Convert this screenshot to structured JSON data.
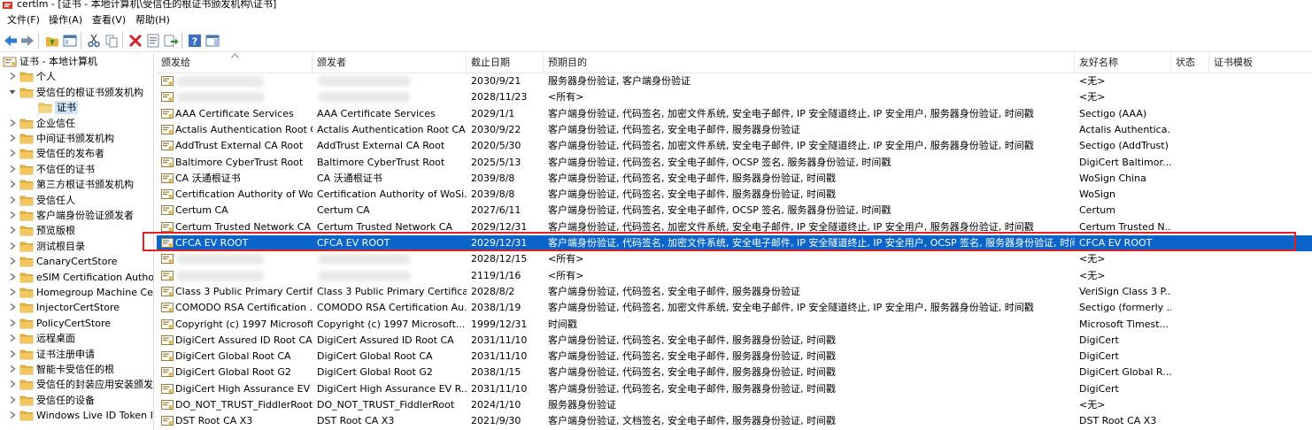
{
  "window": {
    "title": "certlm - [证书 - 本地计算机\\受信任的根证书颁发机构\\证书]"
  },
  "menu": [
    {
      "label": "文件(F)"
    },
    {
      "label": "操作(A)"
    },
    {
      "label": "查看(V)"
    },
    {
      "label": "帮助(H)"
    }
  ],
  "tree": {
    "items": [
      {
        "label": "证书 - 本地计算机",
        "level": 0,
        "expander": "none",
        "icon": "cert-store-icon"
      },
      {
        "label": "个人",
        "level": 1,
        "expander": "collapsed",
        "icon": "folder-icon"
      },
      {
        "label": "受信任的根证书颁发机构",
        "level": 1,
        "expander": "expanded",
        "icon": "folder-icon"
      },
      {
        "label": "证书",
        "level": 2,
        "expander": "none",
        "icon": "folder-open-icon",
        "selected": true
      },
      {
        "label": "企业信任",
        "level": 1,
        "expander": "collapsed",
        "icon": "folder-icon"
      },
      {
        "label": "中间证书颁发机构",
        "level": 1,
        "expander": "collapsed",
        "icon": "folder-icon"
      },
      {
        "label": "受信任的发布者",
        "level": 1,
        "expander": "collapsed",
        "icon": "folder-icon"
      },
      {
        "label": "不信任的证书",
        "level": 1,
        "expander": "collapsed",
        "icon": "folder-icon"
      },
      {
        "label": "第三方根证书颁发机构",
        "level": 1,
        "expander": "collapsed",
        "icon": "folder-icon"
      },
      {
        "label": "受信任人",
        "level": 1,
        "expander": "collapsed",
        "icon": "folder-icon"
      },
      {
        "label": "客户端身份验证颁发者",
        "level": 1,
        "expander": "collapsed",
        "icon": "folder-icon"
      },
      {
        "label": "预览版根",
        "level": 1,
        "expander": "collapsed",
        "icon": "folder-icon"
      },
      {
        "label": "测试根目录",
        "level": 1,
        "expander": "collapsed",
        "icon": "folder-icon"
      },
      {
        "label": "CanaryCertStore",
        "level": 1,
        "expander": "collapsed",
        "icon": "folder-icon"
      },
      {
        "label": "eSIM Certification Authorities",
        "level": 1,
        "expander": "collapsed",
        "icon": "folder-icon"
      },
      {
        "label": "Homegroup Machine Certificates",
        "level": 1,
        "expander": "collapsed",
        "icon": "folder-icon"
      },
      {
        "label": "InjectorCertStore",
        "level": 1,
        "expander": "collapsed",
        "icon": "folder-icon"
      },
      {
        "label": "PolicyCertStore",
        "level": 1,
        "expander": "collapsed",
        "icon": "folder-icon"
      },
      {
        "label": "远程桌面",
        "level": 1,
        "expander": "collapsed",
        "icon": "folder-icon"
      },
      {
        "label": "证书注册申请",
        "level": 1,
        "expander": "collapsed",
        "icon": "folder-icon"
      },
      {
        "label": "智能卡受信任的根",
        "level": 1,
        "expander": "collapsed",
        "icon": "folder-icon"
      },
      {
        "label": "受信任的封装应用安装颁发机构",
        "level": 1,
        "expander": "collapsed",
        "icon": "folder-icon"
      },
      {
        "label": "受信任的设备",
        "level": 1,
        "expander": "collapsed",
        "icon": "folder-icon"
      },
      {
        "label": "Windows Live ID Token Issuer",
        "level": 1,
        "expander": "collapsed",
        "icon": "folder-icon"
      }
    ]
  },
  "list": {
    "columns": [
      "颁发给",
      "颁发者",
      "截止日期",
      "预期目的",
      "友好名称",
      "状态",
      "证书模板"
    ],
    "rows": [
      {
        "issued_to": "",
        "issuer": "",
        "expires": "2030/9/21",
        "purposes": "服务器身份验证, 客户端身份验证",
        "friendly": "<无>",
        "blurred": true
      },
      {
        "issued_to": "",
        "issuer": "",
        "expires": "2028/11/23",
        "purposes": "<所有>",
        "friendly": "<无>",
        "blurred": true
      },
      {
        "issued_to": "AAA Certificate Services",
        "issuer": "AAA Certificate Services",
        "expires": "2029/1/1",
        "purposes": "客户端身份验证, 代码签名, 加密文件系统, 安全电子邮件, IP 安全隧道终止, IP 安全用户, 服务器身份验证, 时间戳",
        "friendly": "Sectigo (AAA)"
      },
      {
        "issued_to": "Actalis Authentication Root CA",
        "issuer": "Actalis Authentication Root CA",
        "expires": "2030/9/22",
        "purposes": "客户端身份验证, 代码签名, 安全电子邮件, 服务器身份验证",
        "friendly": "Actalis Authentica..."
      },
      {
        "issued_to": "AddTrust External CA Root",
        "issuer": "AddTrust External CA Root",
        "expires": "2020/5/30",
        "purposes": "客户端身份验证, 代码签名, 加密文件系统, 安全电子邮件, IP 安全隧道终止, IP 安全用户, 服务器身份验证, 时间戳",
        "friendly": "Sectigo (AddTrust)"
      },
      {
        "issued_to": "Baltimore CyberTrust Root",
        "issuer": "Baltimore CyberTrust Root",
        "expires": "2025/5/13",
        "purposes": "客户端身份验证, 代码签名, 安全电子邮件, OCSP 签名, 服务器身份验证, 时间戳",
        "friendly": "DigiCert Baltimor..."
      },
      {
        "issued_to": "CA 沃通根证书",
        "issuer": "CA 沃通根证书",
        "expires": "2039/8/8",
        "purposes": "客户端身份验证, 代码签名, 安全电子邮件, 服务器身份验证, 时间戳",
        "friendly": "WoSign China"
      },
      {
        "issued_to": "Certification Authority of Wo...",
        "issuer": "Certification Authority of WoSi...",
        "expires": "2039/8/8",
        "purposes": "客户端身份验证, 代码签名, 安全电子邮件, 服务器身份验证, 时间戳",
        "friendly": "WoSign"
      },
      {
        "issued_to": "Certum CA",
        "issuer": "Certum CA",
        "expires": "2027/6/11",
        "purposes": "客户端身份验证, 代码签名, 安全电子邮件, OCSP 签名, 服务器身份验证, 时间戳",
        "friendly": "Certum"
      },
      {
        "issued_to": "Certum Trusted Network CA",
        "issuer": "Certum Trusted Network CA",
        "expires": "2029/12/31",
        "purposes": "客户端身份验证, 代码签名, 加密文件系统, 安全电子邮件, IP 安全隧道终止, IP 安全用户, 服务器身份验证, 时间戳",
        "friendly": "Certum Trusted N..."
      },
      {
        "issued_to": "CFCA EV ROOT",
        "issuer": "CFCA EV ROOT",
        "expires": "2029/12/31",
        "purposes": "客户端身份验证, 代码签名, 加密文件系统, 安全电子邮件, IP 安全隧道终止, IP 安全用户, OCSP 签名, 服务器身份验证, 时间戳",
        "friendly": "CFCA EV ROOT",
        "selected": true
      },
      {
        "issued_to": "",
        "issuer": "",
        "expires": "2028/12/15",
        "purposes": "<所有>",
        "friendly": "<无>",
        "blurred": true
      },
      {
        "issued_to": "",
        "issuer": "",
        "expires": "2119/1/16",
        "purposes": "<所有>",
        "friendly": "<无>",
        "blurred": true
      },
      {
        "issued_to": "Class 3 Public Primary Certifi...",
        "issuer": "Class 3 Public Primary Certifica...",
        "expires": "2028/8/2",
        "purposes": "客户端身份验证, 代码签名, 安全电子邮件, 服务器身份验证",
        "friendly": "VeriSign Class 3 P..."
      },
      {
        "issued_to": "COMODO RSA Certification ...",
        "issuer": "COMODO RSA Certification Au...",
        "expires": "2038/1/19",
        "purposes": "客户端身份验证, 代码签名, 加密文件系统, 安全电子邮件, IP 安全隧道终止, IP 安全用户, 服务器身份验证, 时间戳",
        "friendly": "Sectigo (formerly ..."
      },
      {
        "issued_to": "Copyright (c) 1997 Microsoft...",
        "issuer": "Copyright (c) 1997 Microsoft...",
        "expires": "1999/12/31",
        "purposes": "时间戳",
        "friendly": "Microsoft Timest..."
      },
      {
        "issued_to": "DigiCert Assured ID Root CA",
        "issuer": "DigiCert Assured ID Root CA",
        "expires": "2031/11/10",
        "purposes": "客户端身份验证, 代码签名, 安全电子邮件, 服务器身份验证, 时间戳",
        "friendly": "DigiCert"
      },
      {
        "issued_to": "DigiCert Global Root CA",
        "issuer": "DigiCert Global Root CA",
        "expires": "2031/11/10",
        "purposes": "客户端身份验证, 代码签名, 安全电子邮件, 服务器身份验证, 时间戳",
        "friendly": "DigiCert"
      },
      {
        "issued_to": "DigiCert Global Root G2",
        "issuer": "DigiCert Global Root G2",
        "expires": "2038/1/15",
        "purposes": "客户端身份验证, 代码签名, 安全电子邮件, 服务器身份验证, 时间戳",
        "friendly": "DigiCert Global R..."
      },
      {
        "issued_to": "DigiCert High Assurance EV ...",
        "issuer": "DigiCert High Assurance EV R...",
        "expires": "2031/11/10",
        "purposes": "客户端身份验证, 代码签名, 安全电子邮件, 服务器身份验证, 时间戳",
        "friendly": "DigiCert"
      },
      {
        "issued_to": "DO_NOT_TRUST_FiddlerRoot",
        "issuer": "DO_NOT_TRUST_FiddlerRoot",
        "expires": "2024/1/10",
        "purposes": "服务器身份验证",
        "friendly": "<无>"
      },
      {
        "issued_to": "DST Root CA X3",
        "issuer": "DST Root CA X3",
        "expires": "2021/9/30",
        "purposes": "客户端身份验证, 文档签名, 安全电子邮件, 服务器身份验证, 时间戳",
        "friendly": "DST Root CA X3"
      }
    ]
  },
  "colors": {
    "selection": "#0a64c9",
    "highlight_box": "#e01f26",
    "folder": "#e8b33a"
  }
}
